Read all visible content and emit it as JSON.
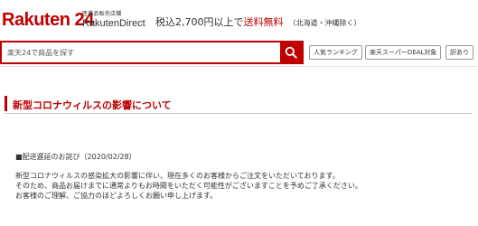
{
  "header": {
    "logo": "Rakuten 24",
    "sub_logo_small": "医薬品販売店舗",
    "sub_logo_big": "RakutenDirect",
    "promo_prefix": "税込2,700円以上で",
    "promo_highlight": "送料無料",
    "promo_note": "（北海道・沖縄除く）"
  },
  "search": {
    "placeholder": "楽天24で商品を探す",
    "value": "楽天24で商品を探す",
    "buttons": [
      "人気ランキング",
      "楽天スーパーDEAL対象",
      "訳あり"
    ]
  },
  "main": {
    "section_title": "新型コロナウィルスの影響について",
    "notice_heading": "■配送遅延のお詫び（2020/02/28）",
    "paragraph_lines": [
      "新型コロナウィルスの感染拡大の影響に伴い、現在多くのお客様からご注文をいただいております。",
      "そのため、商品お届けまでに通常よりもお時間をいただく可能性がございますことを予めご了承ください。",
      "お客様のご理解、ご協力のほどよろしくお願い申し上げます。"
    ]
  },
  "colors": {
    "brand": "#bf0000",
    "text": "#333333",
    "divider": "#e3e3e3"
  },
  "icons": {
    "search_button": "search-icon"
  }
}
